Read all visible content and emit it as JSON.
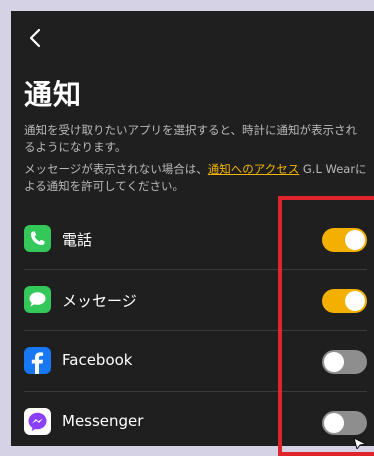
{
  "header": {
    "back_icon": "chevron-left-icon",
    "title": "通知"
  },
  "description": {
    "paragraph1": "通知を受け取りたいアプリを選択すると、時計に通知が表示されるようになります。",
    "paragraph2_before": "メッセージが表示されない場合は、",
    "paragraph2_link": "通知へのアクセス",
    "paragraph2_after": " G.L Wearによる通知を許可してください。"
  },
  "apps": [
    {
      "label": "電話",
      "icon": "phone-app-icon",
      "enabled": true
    },
    {
      "label": "メッセージ",
      "icon": "message-app-icon",
      "enabled": true
    },
    {
      "label": "Facebook",
      "icon": "facebook-app-icon",
      "enabled": false
    },
    {
      "label": "Messenger",
      "icon": "messenger-app-icon",
      "enabled": false
    }
  ],
  "colors": {
    "background": "#1f1f1f",
    "accent": "#f4b000",
    "toggle_off": "#8e8e8e",
    "highlight": "#e0242b",
    "outer": "#d6d2e6"
  }
}
